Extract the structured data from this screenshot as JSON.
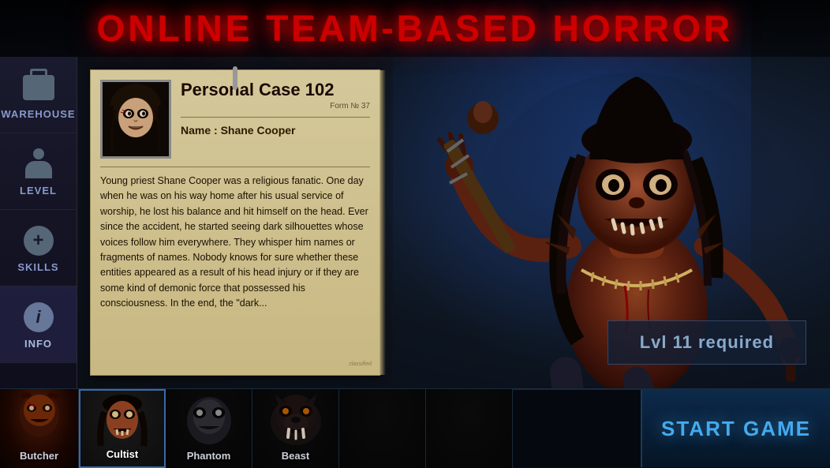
{
  "title": "ONLINE TEAM-BASED HORROR",
  "sidebar": {
    "items": [
      {
        "label": "Warehouse",
        "icon": "warehouse-icon",
        "active": false
      },
      {
        "label": "Level",
        "icon": "level-icon",
        "active": false
      },
      {
        "label": "Skills",
        "icon": "skills-icon",
        "active": false
      },
      {
        "label": "Info",
        "icon": "info-icon",
        "active": true
      }
    ]
  },
  "character_card": {
    "case_number": "Personal Case 102",
    "form_label": "Form № 37",
    "name_label": "Name : Shane Cooper",
    "description": "Young priest Shane Cooper was a religious fanatic. One day when he was on his way home after his usual service of worship, he lost his balance and hit himself on the head. Ever since the accident, he started seeing dark silhouettes whose voices follow him everywhere. They whisper him names or fragments of names. Nobody knows for sure whether these entities appeared as a result of his head injury or if they are some kind of demonic force that possessed his consciousness. In the end, the \"dark..."
  },
  "level_required": "Lvl 11 required",
  "bottom_bar": {
    "characters": [
      {
        "label": "Butcher",
        "selected": false
      },
      {
        "label": "Cultist",
        "selected": true
      },
      {
        "label": "Phantom",
        "selected": false
      },
      {
        "label": "Beast",
        "selected": false
      },
      {
        "label": "",
        "selected": false
      },
      {
        "label": "",
        "selected": false
      }
    ],
    "start_button": "START GAME"
  },
  "colors": {
    "title_red": "#cc0000",
    "sidebar_bg": "#1a1a2e",
    "card_bg": "#d4c89a",
    "level_banner_text": "#88aacc",
    "start_btn_text": "#44aaee"
  }
}
